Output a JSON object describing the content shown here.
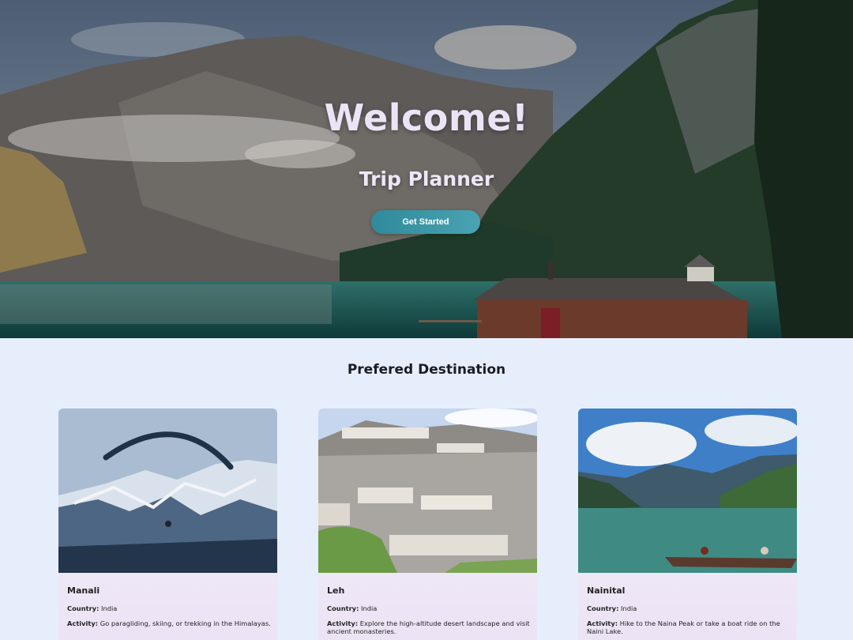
{
  "hero": {
    "title": "Welcome!",
    "subtitle": "Trip Planner",
    "cta_label": "Get Started"
  },
  "section": {
    "title": "Prefered Destination"
  },
  "destinations": [
    {
      "name": "Manali",
      "country_label": "Country:",
      "country": "India",
      "activity_label": "Activity:",
      "activity": "Go paragliding, skiing, or trekking in the Himalayas."
    },
    {
      "name": "Leh",
      "country_label": "Country:",
      "country": "India",
      "activity_label": "Activity:",
      "activity": "Explore the high-altitude desert landscape and visit ancient monasteries."
    },
    {
      "name": "Nainital",
      "country_label": "Country:",
      "country": "India",
      "activity_label": "Activity:",
      "activity": "Hike to the Naina Peak or take a boat ride on the Naini Lake."
    }
  ],
  "colors": {
    "page_background": "#e7eefb",
    "button_gradient_start": "#2f8a9b",
    "button_gradient_end": "#4aa3b2",
    "card_background": "#f0ebf7"
  }
}
